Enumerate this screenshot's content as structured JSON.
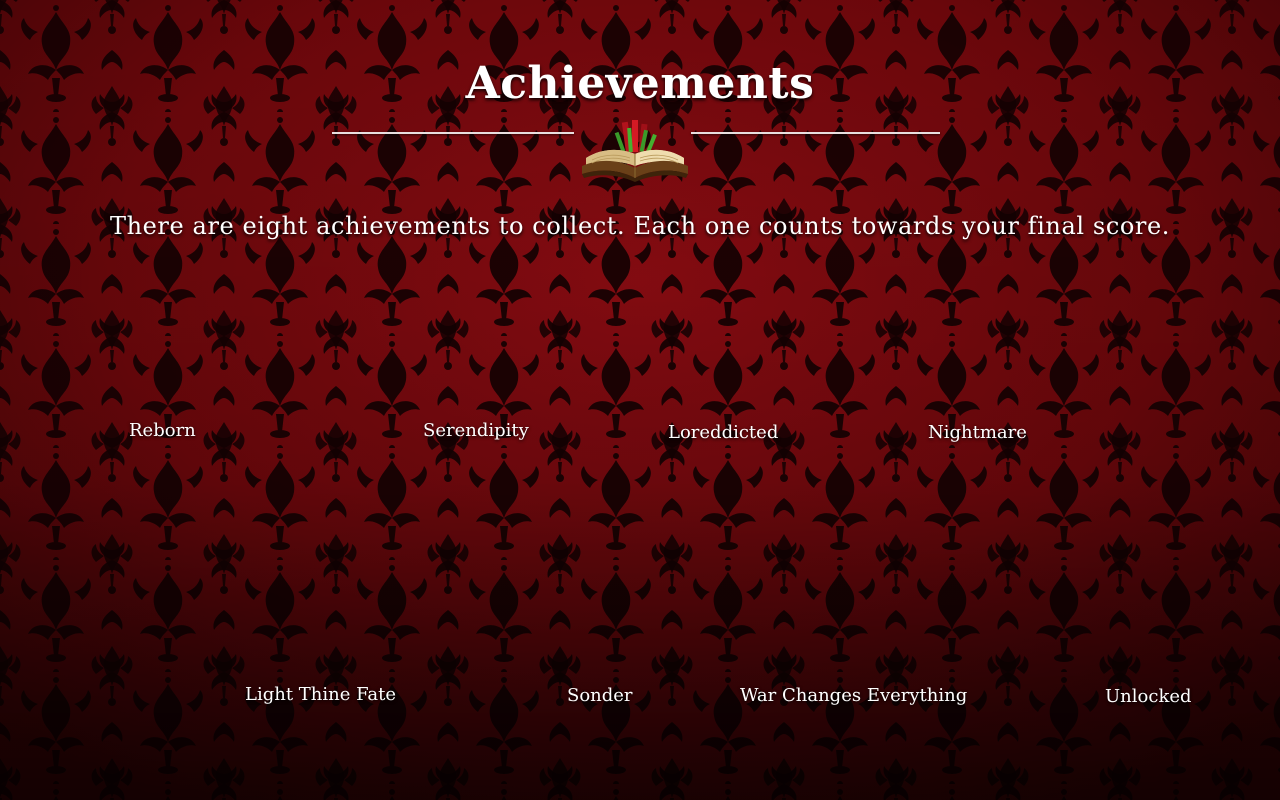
{
  "screen": {
    "title": "Achievements",
    "subtitle": "There are eight achievements to collect. Each one counts towards your final score."
  },
  "icons": {
    "divider": "open-book-with-bookmarks-icon"
  },
  "colors": {
    "background_red": "#7a0a0e",
    "background_dark": "#240203",
    "pattern": "#120102",
    "text": "#ffffff",
    "rule": "#e8dede"
  },
  "achievements": [
    {
      "label": "Reborn"
    },
    {
      "label": "Serendipity"
    },
    {
      "label": "Loreddicted"
    },
    {
      "label": "Nightmare"
    },
    {
      "label": "Light Thine Fate"
    },
    {
      "label": "Sonder"
    },
    {
      "label": "War Changes Everything"
    },
    {
      "label": "Unlocked"
    }
  ]
}
